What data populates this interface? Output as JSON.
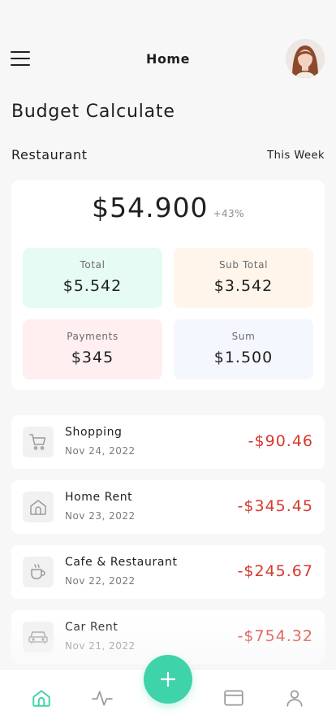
{
  "header": {
    "title": "Home"
  },
  "page": {
    "title": "Budget Calculate"
  },
  "section": {
    "title": "Restaurant",
    "period": "This Week"
  },
  "summary": {
    "amount": "$54.900",
    "change": "+43%",
    "tiles": [
      {
        "label": "Total",
        "value": "$5.542",
        "color": "#e6fbf4"
      },
      {
        "label": "Sub Total",
        "value": "$3.542",
        "color": "#fff5eb"
      },
      {
        "label": "Payments",
        "value": "$345",
        "color": "#ffeff0"
      },
      {
        "label": "Sum",
        "value": "$1.500",
        "color": "#f5f7fe"
      }
    ]
  },
  "transactions": [
    {
      "icon": "cart-icon",
      "name": "Shopping",
      "date": "Nov 24, 2022",
      "amount": "-$90.46"
    },
    {
      "icon": "home-icon",
      "name": "Home Rent",
      "date": "Nov 23, 2022",
      "amount": "-$345.45"
    },
    {
      "icon": "coffee-icon",
      "name": "Cafe & Restaurant",
      "date": "Nov 22, 2022",
      "amount": "-$245.67"
    },
    {
      "icon": "car-icon",
      "name": "Car Rent",
      "date": "Nov 21, 2022",
      "amount": "-$754.32"
    }
  ],
  "colors": {
    "accent": "#3fd3a9",
    "negative": "#d53a2f"
  },
  "tabs": [
    "home-icon",
    "activity-icon",
    "card-icon",
    "profile-icon"
  ]
}
